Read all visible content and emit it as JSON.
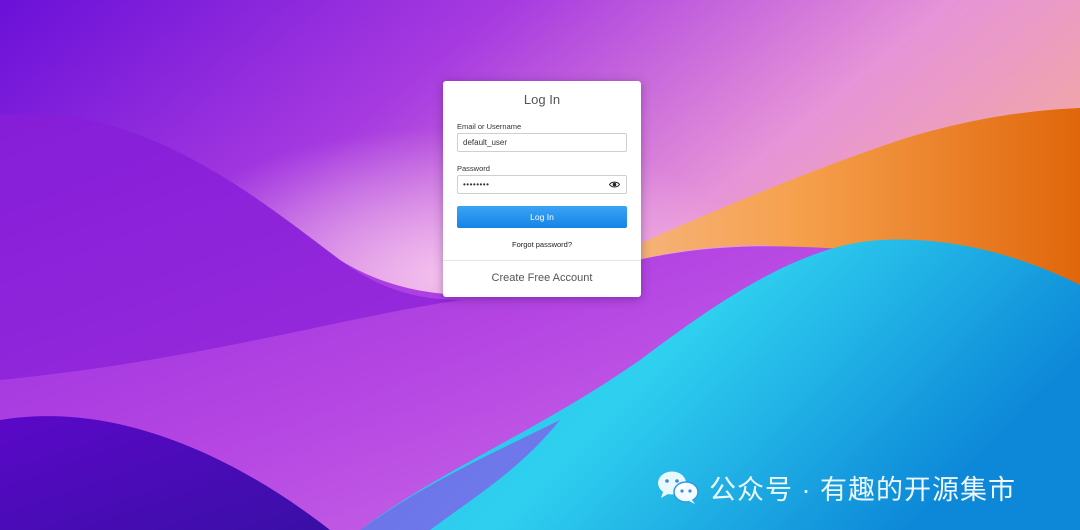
{
  "login": {
    "title": "Log In",
    "username_label": "Email or Username",
    "username_value": "default_user",
    "password_label": "Password",
    "password_value": "secretpw",
    "submit_label": "Log In",
    "forgot_label": "Forgot password?",
    "create_account_label": "Create Free Account",
    "eye_icon": "eye-icon"
  },
  "watermark": {
    "text": "公众号 · 有趣的开源集市",
    "icon": "wechat-icon"
  },
  "colors": {
    "button": "#1683e6",
    "wallpaper_purple": "#8a2be2",
    "wallpaper_orange": "#ee7f10",
    "wallpaper_cyan": "#27c4ea"
  }
}
